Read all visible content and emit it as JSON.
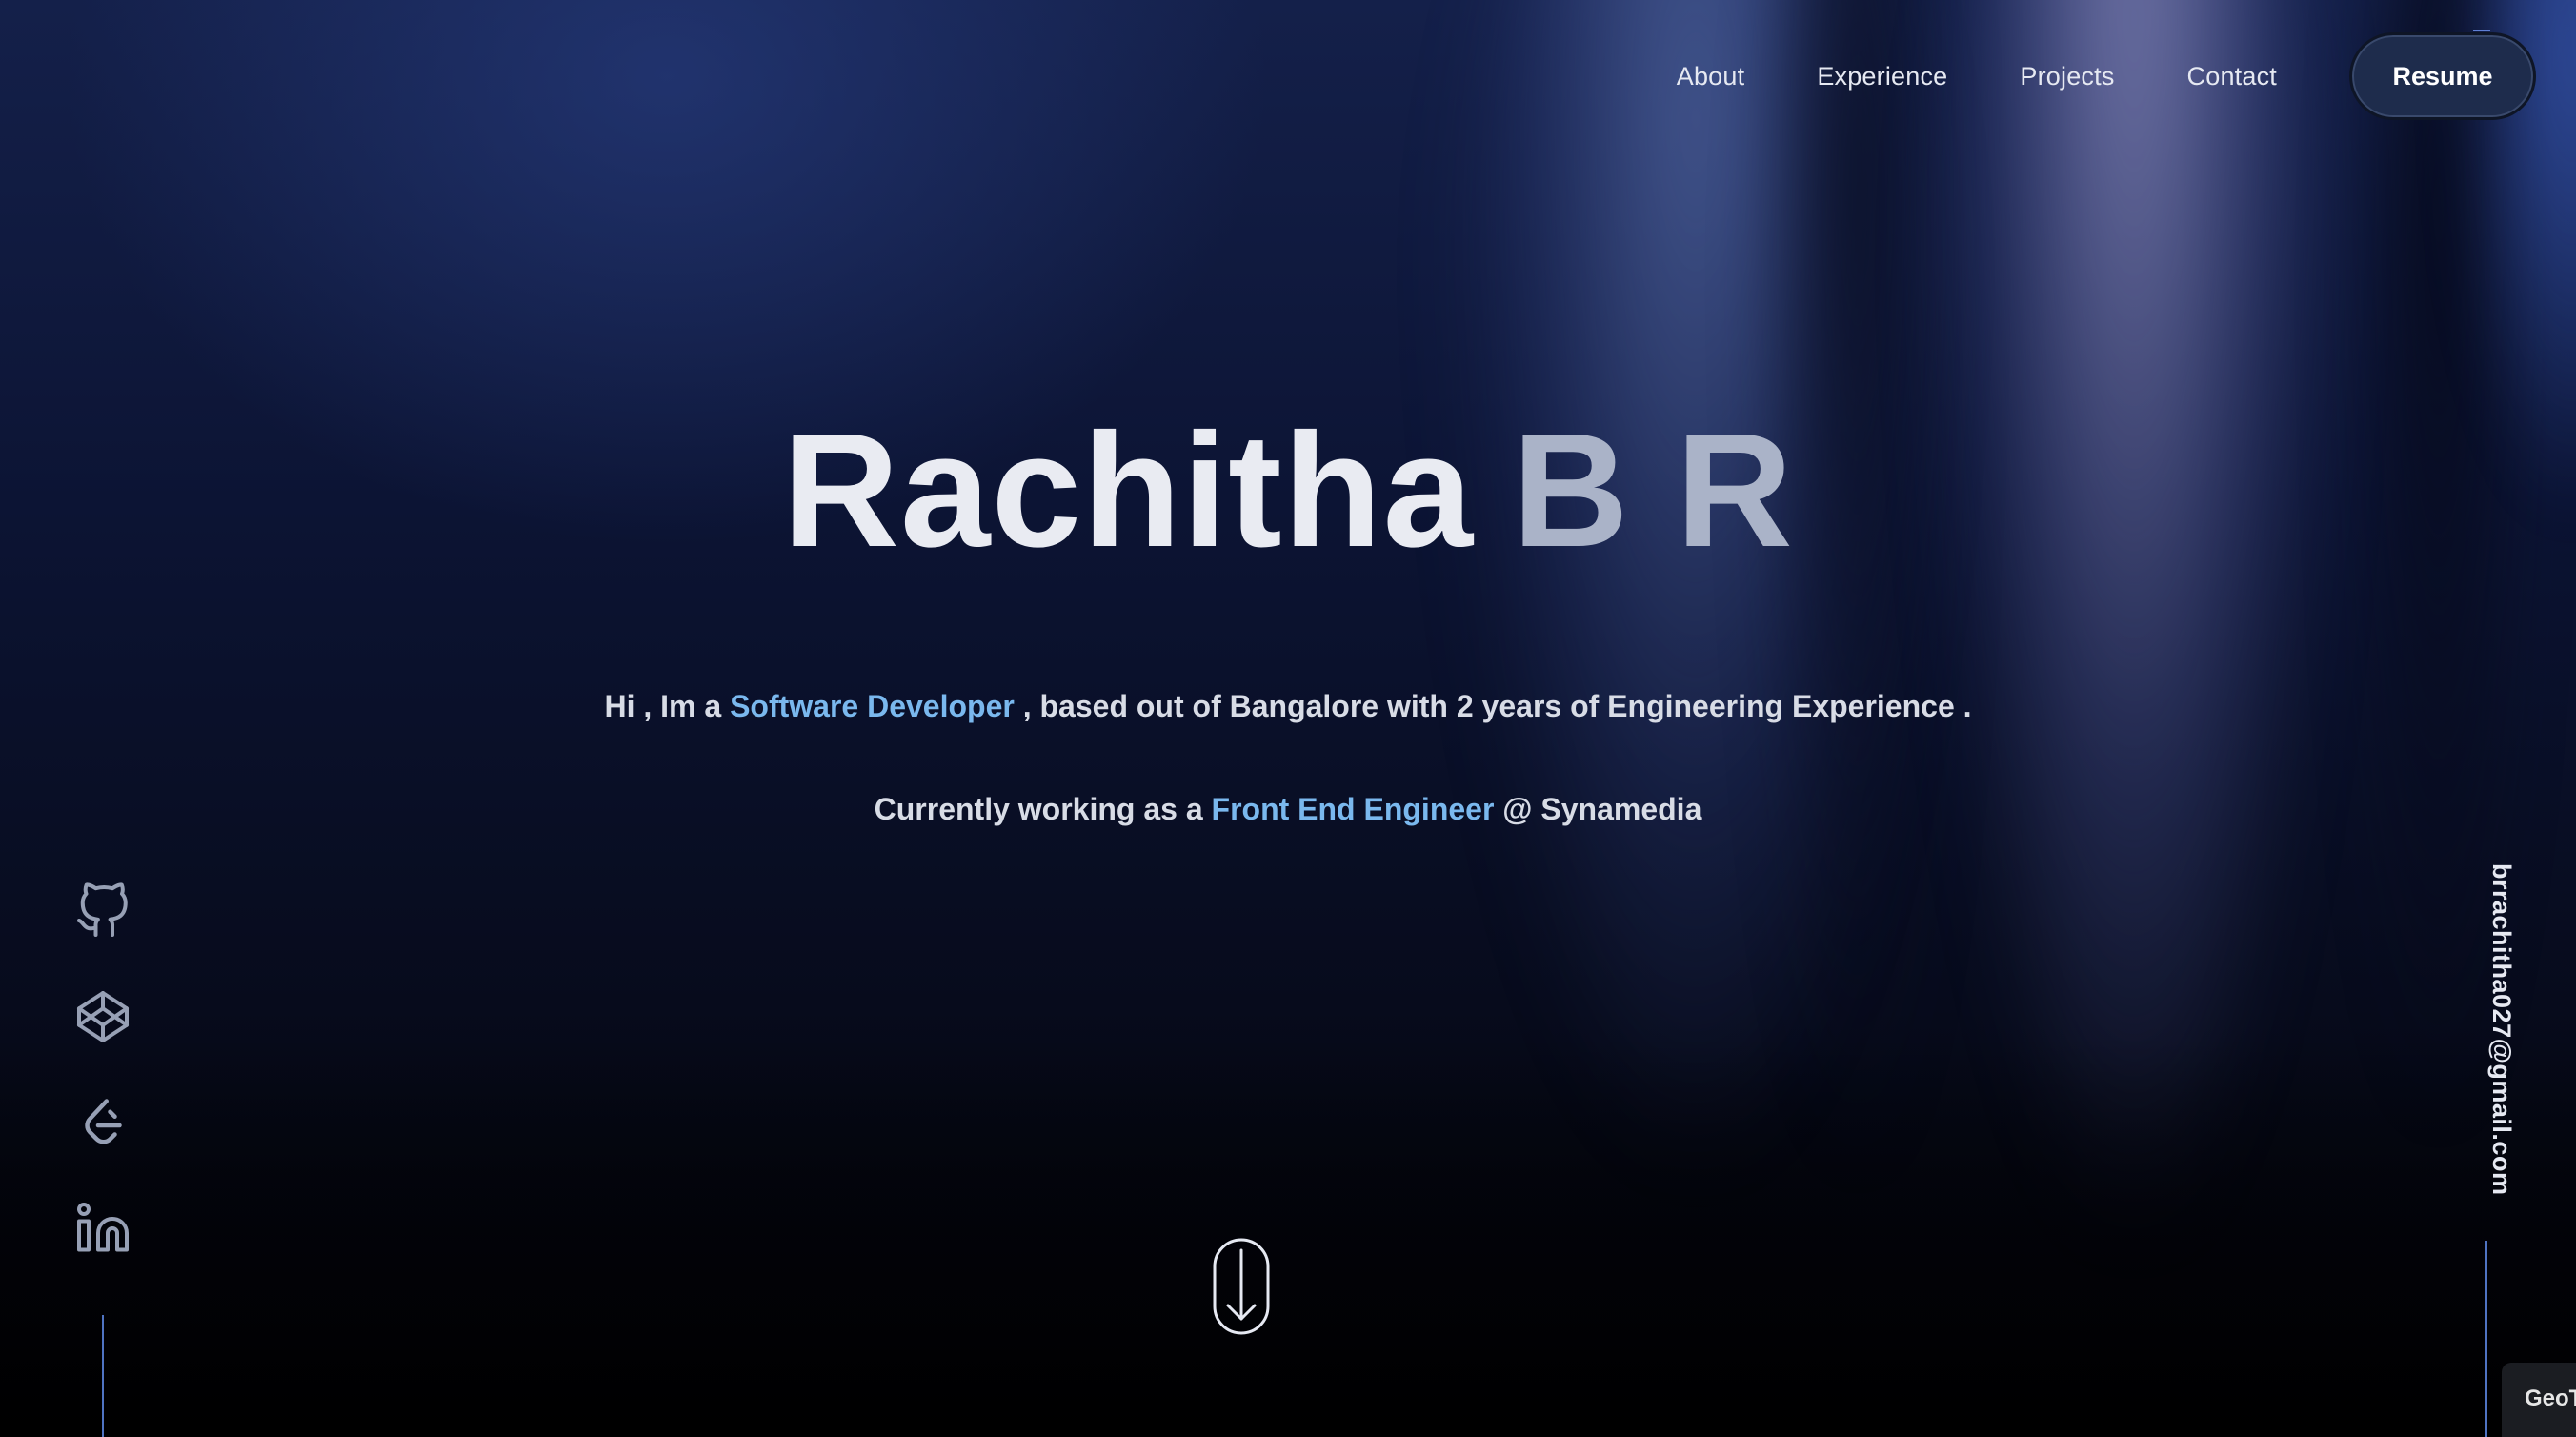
{
  "nav": {
    "links": [
      "About",
      "Experience",
      "Projects",
      "Contact"
    ],
    "resume_label": "Resume"
  },
  "hero": {
    "first_name": "Rachitha",
    "last_name": "B R",
    "line1": {
      "prefix": "Hi , Im a ",
      "highlight": "Software Developer",
      "suffix": " , based out of Bangalore with 2 years of Engineering Experience ."
    },
    "line2": {
      "prefix": "Currently working as a ",
      "highlight": "Front End Engineer",
      "suffix": " @ Synamedia"
    }
  },
  "socials": [
    {
      "icon": "github-icon"
    },
    {
      "icon": "codepen-icon"
    },
    {
      "icon": "leetcode-icon"
    },
    {
      "icon": "linkedin-icon"
    }
  ],
  "email": "brrachitha027@gmail.com",
  "scroll_indicator": {
    "icon": "scroll-down-arrow-icon"
  },
  "geo_tab": {
    "label": "GeoT"
  },
  "colors": {
    "accent": "#7ab8ee",
    "line": "#4f73c2",
    "resume_bg": "#1e2c4c"
  }
}
